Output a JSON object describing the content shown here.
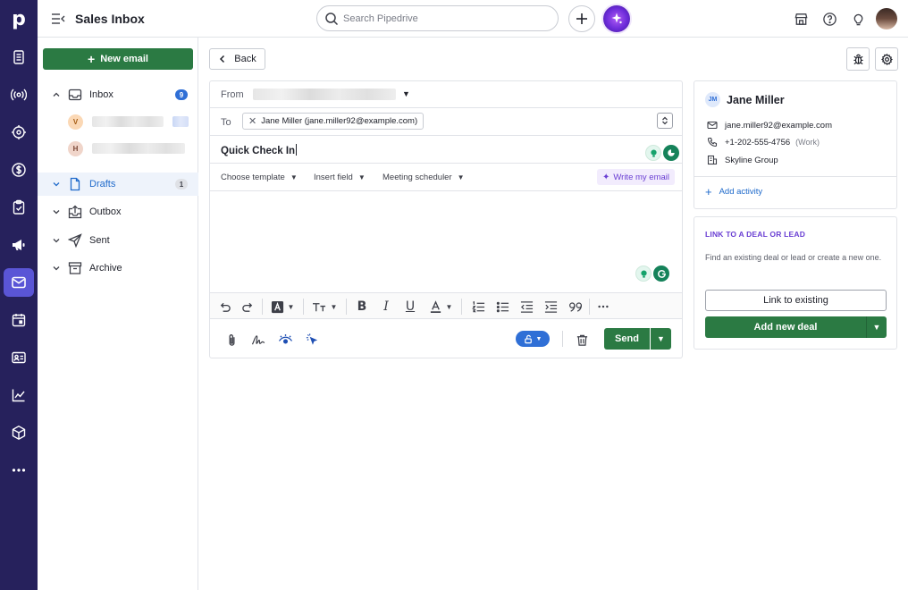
{
  "app": {
    "title": "Sales Inbox",
    "logo_letter": "p"
  },
  "search": {
    "placeholder": "Search Pipedrive"
  },
  "sidebar": {
    "new_email_label": "New email",
    "folders": [
      {
        "label": "Inbox",
        "count": "9"
      },
      {
        "label": "Drafts",
        "count": "1"
      },
      {
        "label": "Outbox"
      },
      {
        "label": "Sent"
      },
      {
        "label": "Archive"
      }
    ],
    "accounts": [
      {
        "initial": "V"
      },
      {
        "initial": "H"
      }
    ]
  },
  "compose": {
    "back_label": "Back",
    "from_label": "From",
    "to_label": "To",
    "recipient": "Jane Miller (jane.miller92@example.com)",
    "subject": "Quick Check In",
    "tools": {
      "template": "Choose template",
      "insert_field": "Insert field",
      "meeting": "Meeting scheduler",
      "write_ai": "Write my email"
    },
    "send_label": "Send"
  },
  "person": {
    "initials": "JM",
    "name": "Jane Miller",
    "email": "jane.miller92@example.com",
    "phone": "+1-202-555-4756",
    "phone_type": "(Work)",
    "org": "Skyline Group",
    "add_activity": "Add activity"
  },
  "link_panel": {
    "title": "LINK TO A DEAL OR LEAD",
    "description": "Find an existing deal or lead or create a new one.",
    "link_existing": "Link to existing",
    "add_new_deal": "Add new deal"
  },
  "colors": {
    "rail": "#26215c",
    "rail_active": "#5a55d6",
    "primary_green": "#2b7a43",
    "link_blue": "#1f6acb",
    "ai_purple": "#6a3fd3"
  }
}
